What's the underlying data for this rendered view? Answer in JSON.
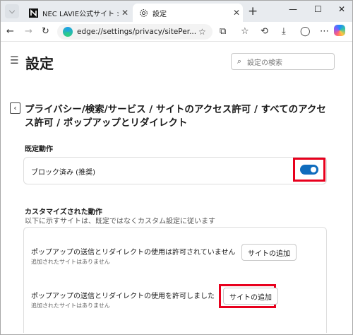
{
  "tabs": [
    {
      "title": "NEC LAVIE公式サイト > サービス&",
      "close": "✕"
    },
    {
      "title": "設定",
      "close": "✕"
    }
  ],
  "window_controls": {
    "minimize": "—",
    "maximize": "☐",
    "close": "✕"
  },
  "toolbar": {
    "url": "edge://settings/privacy/sitePer..."
  },
  "settings": {
    "title": "設定",
    "search_placeholder": "設定の検索"
  },
  "breadcrumb": {
    "text": "プライバシー/検索/サービス / サイトのアクセス許可 / すべてのアクセス許可 / ポップアップとリダイレクト"
  },
  "default_behavior": {
    "heading": "既定動作",
    "label": "ブロック済み (推奨)",
    "toggle_on": true
  },
  "customized": {
    "heading": "カスタマイズされた動作",
    "description": "以下に示すサイトは、既定ではなくカスタム設定に従います",
    "rows": [
      {
        "title": "ポップアップの送信とリダイレクトの使用は許可されていません",
        "subtitle": "追加されたサイトはありません",
        "button": "サイトの追加"
      },
      {
        "title": "ポップアップの送信とリダイレクトの使用を許可しました",
        "subtitle": "追加されたサイトはありません",
        "button": "サイトの追加"
      }
    ]
  },
  "colors": {
    "accent": "#0f6cbd",
    "highlight": "#e8001d"
  }
}
